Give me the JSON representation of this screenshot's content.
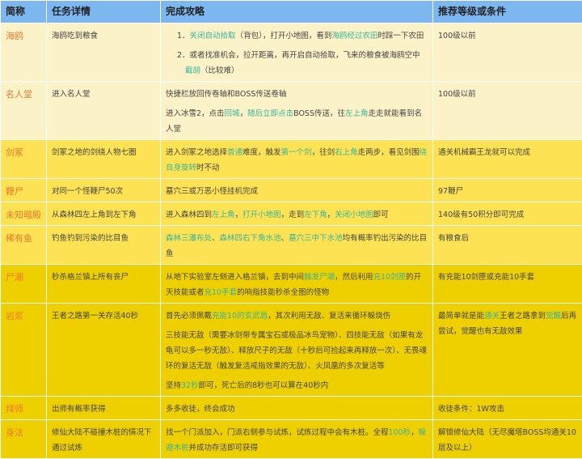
{
  "colors": {
    "header": "#7db7ef",
    "row_light": "#fbf2c8",
    "row_mid": "#fde353",
    "row_dark": "#eecf00",
    "name": "#f07a2a",
    "highlight": "#38b59b"
  },
  "headers": [
    "简称",
    "任务详情",
    "完成攻略",
    "推荐等级或条件"
  ],
  "rows": [
    {
      "shade": "l",
      "name": "海鸥",
      "detail": "海鸥吃到粮食",
      "condition": "100级以前",
      "numbered": true,
      "strategy": [
        [
          {
            "t": "1．"
          },
          {
            "t": "关闭自动拾取",
            "h": 1
          },
          {
            "t": "（背包），打开小地图，看到"
          },
          {
            "t": "海鸥经过农田",
            "h": 1
          },
          {
            "t": "时踩一下农田"
          }
        ],
        [
          {
            "t": "2．或者找准机会，拉开距离，再开启自动拾取，飞来的粮食被海鸥空中"
          },
          {
            "t": "截胡",
            "h": 1
          },
          {
            "t": "（比较难）"
          }
        ]
      ]
    },
    {
      "shade": "l",
      "name": "名人堂",
      "detail": "进入名人堂",
      "condition": "100级以前",
      "strategy": [
        [
          {
            "t": "快捷栏放回传卷轴和BOSS传送卷轴"
          }
        ],
        [
          {
            "t": "进入冰雪2，点击"
          },
          {
            "t": "回城",
            "h": 1
          },
          {
            "t": "，"
          },
          {
            "t": "随后立即点击",
            "h": 1
          },
          {
            "t": "BOSS传送，往"
          },
          {
            "t": "左上角",
            "h": 1
          },
          {
            "t": "走走就能看到名人堂"
          }
        ]
      ]
    },
    {
      "shade": "m",
      "name": "剑冢",
      "detail": "剑冢之地的剑绕人物七圈",
      "condition": "通关机械霸王龙就可以完成",
      "strategy": [
        [
          {
            "t": "进入剑冢之地选择"
          },
          {
            "t": "普通",
            "h": 1
          },
          {
            "t": "难度，触发"
          },
          {
            "t": "第一个剑",
            "h": 1
          },
          {
            "t": "，往剑"
          },
          {
            "t": "右上角",
            "h": 1
          },
          {
            "t": "走两步，看见剑围"
          },
          {
            "t": "绕自身旋转",
            "h": 1
          },
          {
            "t": "时不动"
          }
        ]
      ]
    },
    {
      "shade": "m",
      "name": "鞭尸",
      "detail": "对同一个怪鞭尸50次",
      "condition": "97鞭尸",
      "strategy": [
        [
          {
            "t": "墓穴三或万恶小怪挂机完成"
          }
        ]
      ]
    },
    {
      "shade": "m",
      "name": "未知暗殿",
      "detail": "从森林四左上角到左下角",
      "condition": "140级有50积分即可完成",
      "strategy": [
        [
          {
            "t": "进入森林四到"
          },
          {
            "t": "左上角",
            "h": 1
          },
          {
            "t": "，"
          },
          {
            "t": "打开小地图",
            "h": 1
          },
          {
            "t": "，走到"
          },
          {
            "t": "左下角",
            "h": 1
          },
          {
            "t": "，"
          },
          {
            "t": "关闭小地图",
            "h": 1
          },
          {
            "t": "即可"
          }
        ]
      ]
    },
    {
      "shade": "m",
      "name": "稀有鱼",
      "detail": "钓鱼钓到污染的比目鱼",
      "condition": "有粮食后",
      "strategy": [
        [
          {
            "t": "森林三瀑布处",
            "h": 1
          },
          {
            "t": "、"
          },
          {
            "t": "森林四右下角水池",
            "h": 1
          },
          {
            "t": "、"
          },
          {
            "t": "墓穴三中下水池",
            "h": 1
          },
          {
            "t": "均有概率钓出污染的比目鱼"
          }
        ]
      ]
    },
    {
      "shade": "d",
      "name": "尸潮",
      "detail": "秒杀格兰镇上所有丧尸",
      "condition": "有充能10剑匣或充能10手套",
      "strategy": [
        [
          {
            "t": "从地下实验室左侧进入格兰镇，去到中间"
          },
          {
            "t": "触发尸潮",
            "h": 1
          },
          {
            "t": "，然后利用"
          },
          {
            "t": "充10剑匣",
            "h": 1
          },
          {
            "t": "的开天技能或者"
          },
          {
            "t": "充10手套",
            "h": 1
          },
          {
            "t": "的响指技能秒杀全图的怪物"
          }
        ]
      ]
    },
    {
      "shade": "d",
      "name": "岩浆",
      "detail": "王者之路第一关存活40秒",
      "condition_segs": [
        {
          "t": "最简单就是能"
        },
        {
          "t": "通关",
          "h": 1
        },
        {
          "t": "王者之路拿到"
        },
        {
          "t": "觉醒",
          "h": 1
        },
        {
          "t": "后再尝试，觉醒也有无敌效果"
        }
      ],
      "strategy": [
        [
          {
            "t": "首先必须佩戴"
          },
          {
            "t": "充能10的玄武盾",
            "h": 1
          },
          {
            "t": "，其次利用无敌、复活来循环躲烧伤"
          }
        ],
        [
          {
            "t": "三技能无敌（需要冰剑带专属宝石或极品冰鸟宠物）、四技能无敌（如果有龙龟可以多一秒无敌）、释放尺子的无敌（十秒后可捡起来再释放一次）、无畏魂环的复活无敌（触发复活戒指效果的无敌）、火凤凰的多次复活等"
          }
        ],
        [
          {
            "t": "坚持"
          },
          {
            "t": "32秒",
            "h": 1
          },
          {
            "t": "即可，死亡后的8秒也可以算在40秒内"
          }
        ]
      ]
    },
    {
      "shade": "d",
      "name": "拜师",
      "detail": "出师有概率获得",
      "condition": "收徒条件：1W攻击",
      "strategy": [
        [
          {
            "t": "多多收徒，终会成功"
          }
        ]
      ]
    },
    {
      "shade": "d",
      "name": "身法",
      "detail": "修仙大陆不碰撞木桩的情况下通过试炼",
      "condition": "解锁修仙大陆（无尽魔塔BOSS均通关10层及以上）",
      "strategy": [
        [
          {
            "t": "找一个门派加入，门派右侧参与试炼，试炼过程中会有木桩。全程"
          },
          {
            "t": "100秒",
            "h": 1
          },
          {
            "t": "，"
          },
          {
            "t": "躲避木桩",
            "h": 1
          },
          {
            "t": "并成功存活即可获得"
          }
        ]
      ]
    }
  ]
}
